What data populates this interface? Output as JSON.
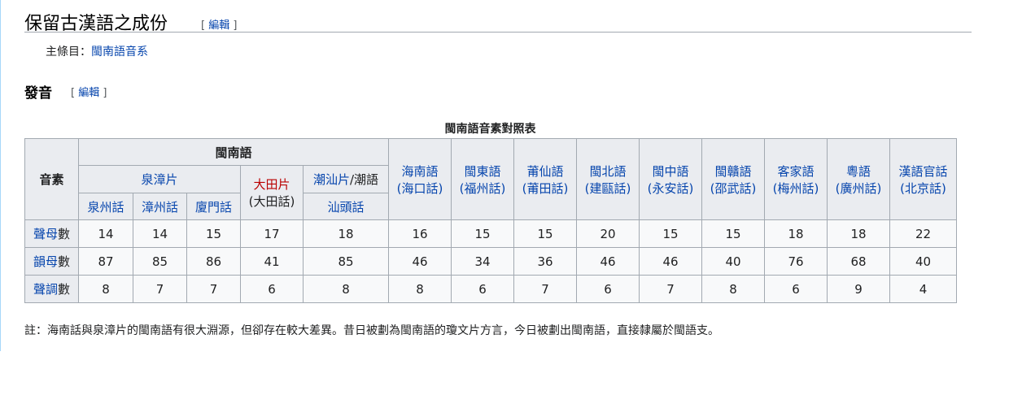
{
  "section": {
    "title": "保留古漢語之成份",
    "edit_open": "[",
    "edit_label": "編輯",
    "edit_close": "]"
  },
  "hatnote": {
    "prefix": "主條目：",
    "link": "閩南語音系"
  },
  "subsection": {
    "title": "發音",
    "edit_open": "[",
    "edit_label": "編輯",
    "edit_close": "]"
  },
  "table": {
    "caption": "閩南語音素對照表",
    "corner": "音素",
    "minnan_group": "閩南語",
    "quanzhang": "泉漳片",
    "datian": "大田片",
    "datian_sub": "(大田話)",
    "chaoshan": "潮汕片",
    "chaoshan_suffix": "/潮語",
    "shantou": "汕頭話",
    "quanzhou": "泉州話",
    "zhangzhou": "漳州話",
    "xiamen": "廈門話",
    "others": [
      {
        "name": "海南語",
        "sub": "(海口話)"
      },
      {
        "name": "閩東語",
        "sub": "(福州話)"
      },
      {
        "name": "莆仙語",
        "sub": "(莆田話)"
      },
      {
        "name": "閩北語",
        "sub": "(建甌話)"
      },
      {
        "name": "閩中語",
        "sub": "(永安話)"
      },
      {
        "name": "閩贛語",
        "sub": "(邵武話)"
      },
      {
        "name": "客家語",
        "sub": "(梅州話)"
      },
      {
        "name": "粵語",
        "sub": "(廣州話)"
      },
      {
        "name": "漢語官話",
        "sub": "(北京話)"
      }
    ],
    "rows": [
      {
        "a": "聲母",
        "b": "數",
        "values": [
          "14",
          "14",
          "15",
          "17",
          "18",
          "16",
          "15",
          "15",
          "20",
          "15",
          "15",
          "18",
          "18",
          "22"
        ]
      },
      {
        "a": "韻母",
        "b": "數",
        "values": [
          "87",
          "85",
          "86",
          "41",
          "85",
          "46",
          "34",
          "36",
          "46",
          "46",
          "40",
          "76",
          "68",
          "40"
        ]
      },
      {
        "a": "聲調",
        "b": "數",
        "values": [
          "8",
          "7",
          "7",
          "6",
          "8",
          "8",
          "6",
          "7",
          "6",
          "7",
          "8",
          "6",
          "9",
          "4"
        ]
      }
    ]
  },
  "note": "註：海南話與泉漳片的閩南語有很大淵源，但卻存在較大差異。昔日被劃為閩南語的瓊文片方言，今日被劃出閩南語，直接隸屬於閩語支。"
}
